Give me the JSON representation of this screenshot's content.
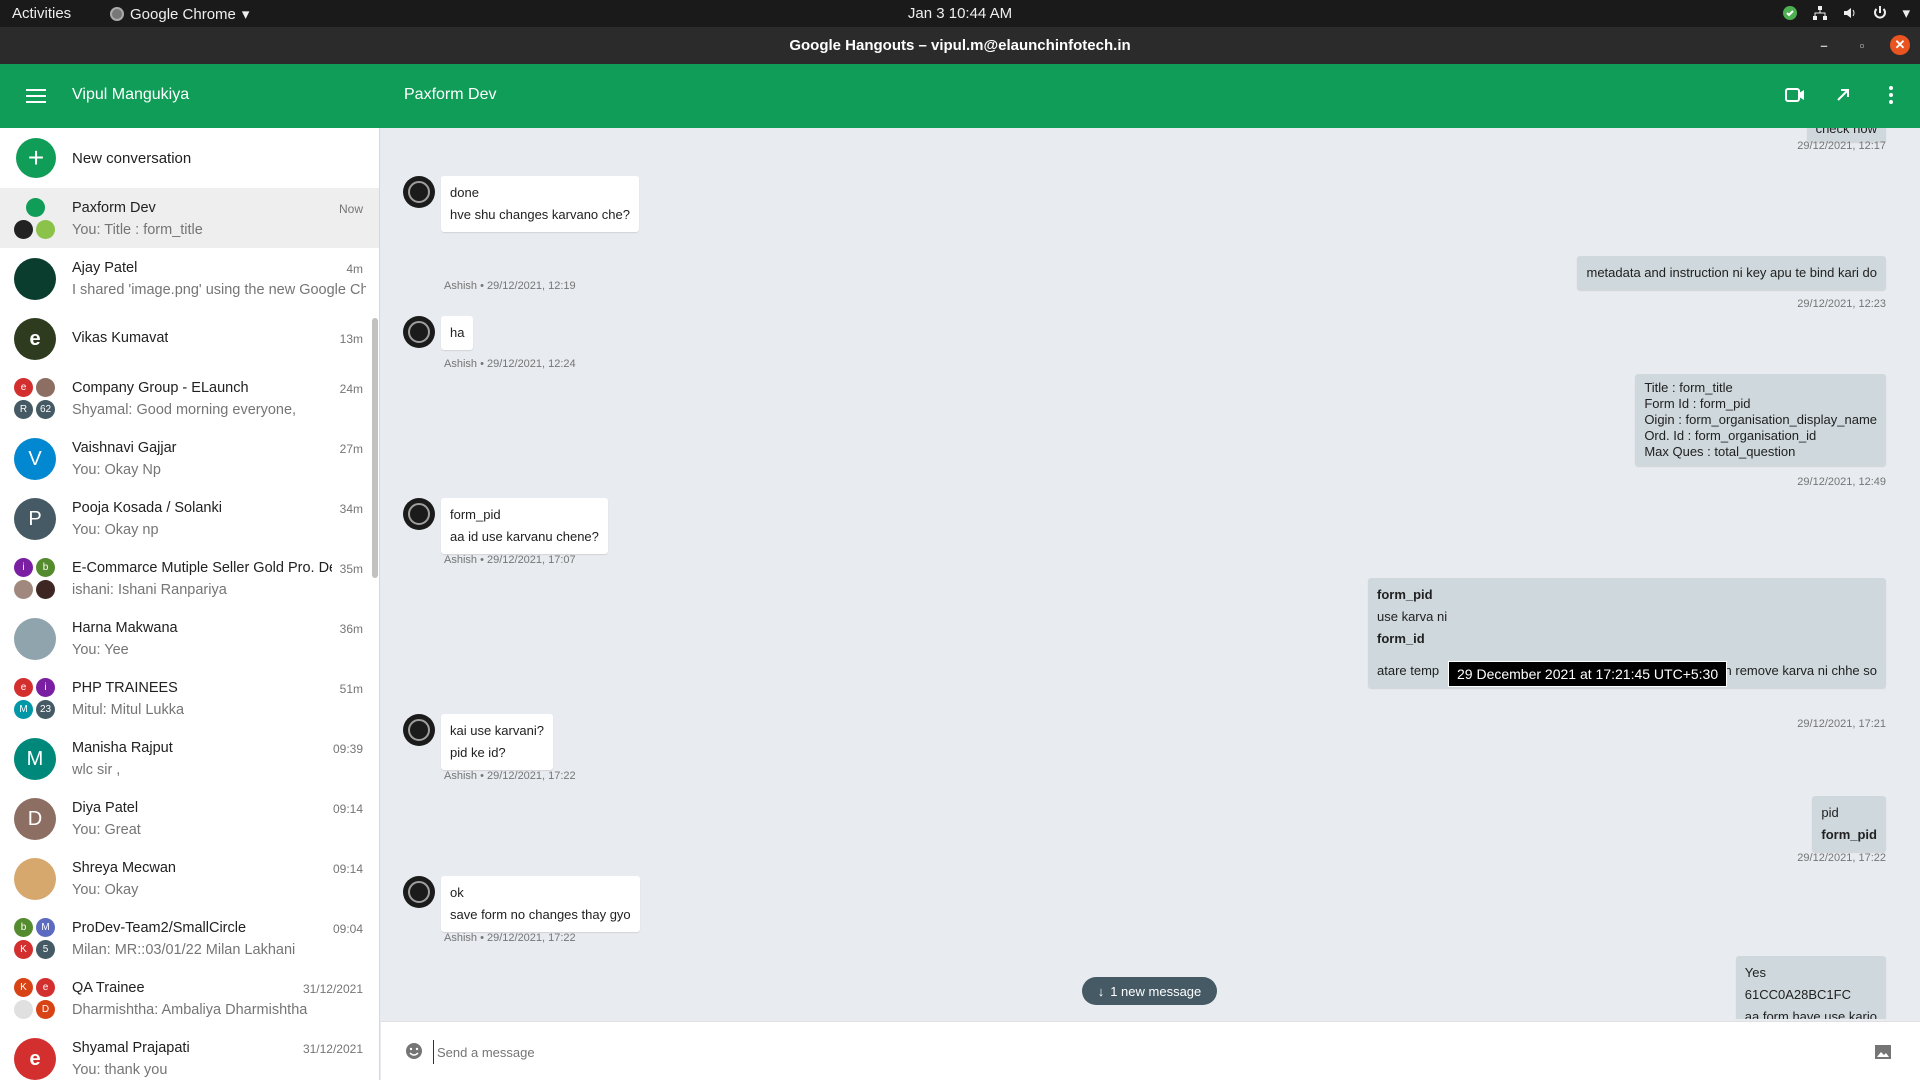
{
  "topbar": {
    "activities": "Activities",
    "app_name": "Google Chrome",
    "datetime": "Jan 3  10:44 AM"
  },
  "window": {
    "title": "Google Hangouts – vipul.m@elaunchinfotech.in"
  },
  "header": {
    "user_name": "Vipul Mangukiya",
    "conversation_title": "Paxform Dev"
  },
  "sidebar": {
    "new_conversation": "New conversation",
    "conversations": [
      {
        "name": "Paxform Dev",
        "snippet": "You: Title :  form_title",
        "time": "Now"
      },
      {
        "name": "Ajay Patel",
        "snippet": "I shared 'image.png' using the new Google Chat",
        "time": "4m"
      },
      {
        "name": "Vikas Kumavat",
        "snippet": "",
        "time": "13m",
        "initial": "e"
      },
      {
        "name": "Company Group - ELaunch",
        "snippet": "Shyamal: Good morning everyone,",
        "time": "24m",
        "a1": "e",
        "a3": "R",
        "a4": "62"
      },
      {
        "name": "Vaishnavi Gajjar",
        "snippet": "You: Okay  Np",
        "time": "27m",
        "initial": "V"
      },
      {
        "name": "Pooja Kosada / Solanki",
        "snippet": "You: Okay np",
        "time": "34m",
        "initial": "P"
      },
      {
        "name": "E-Commarce Mutiple Seller Gold Pro. Dev",
        "snippet": "ishani: Ishani Ranpariya",
        "time": "35m",
        "a1": "i",
        "a2": "b"
      },
      {
        "name": "Harna Makwana",
        "snippet": "You: Yee",
        "time": "36m"
      },
      {
        "name": "PHP TRAINEES",
        "snippet": "Mitul: Mitul Lukka",
        "time": "51m",
        "a1": "e",
        "a2": "i",
        "a3": "M",
        "a4": "23"
      },
      {
        "name": "Manisha Rajput",
        "snippet": "wlc sir ,",
        "time": "09:39",
        "initial": "M"
      },
      {
        "name": "Diya Patel",
        "snippet": "You: Great",
        "time": "09:14",
        "initial": "D"
      },
      {
        "name": "Shreya Mecwan",
        "snippet": "You: Okay",
        "time": "09:14"
      },
      {
        "name": "ProDev-Team2/SmallCircle",
        "snippet": "Milan: MR::03/01/22 Milan Lakhani",
        "time": "09:04",
        "a1": "b",
        "a2": "M",
        "a3": "K",
        "a4": "5"
      },
      {
        "name": "QA Trainee",
        "snippet": "Dharmishtha: Ambaliya Dharmishtha",
        "time": "31/12/2021",
        "a1": "K",
        "a2": "e",
        "a4": "D"
      },
      {
        "name": "Shyamal Prajapati",
        "snippet": "You: thank you",
        "time": "31/12/2021",
        "initial": "e"
      }
    ]
  },
  "messages": [
    {
      "lines": [
        "check now"
      ],
      "meta": "29/12/2021, 12:17"
    },
    {
      "lines": [
        "done",
        "hve shu changes karvano che?"
      ],
      "meta": "Ashish • 29/12/2021, 12:19"
    },
    {
      "lines": [
        "metadata and instruction ni  key apu te bind  kari do"
      ],
      "meta": "29/12/2021, 12:23"
    },
    {
      "lines": [
        "ha"
      ],
      "meta": "Ashish • 29/12/2021, 12:24"
    },
    {
      "lines": [
        "Title :  form_title",
        "Form Id : form_pid",
        "Oigin :  form_organisation_display_name",
        "Ord. Id : form_organisation_id",
        "Max Ques : total_question"
      ],
      "meta": "29/12/2021, 12:49"
    },
    {
      "lines": [
        "form_pid",
        "aa id use karvanu chene?"
      ],
      "meta": "Ashish • 29/12/2021, 17:07"
    },
    {
      "lines": [
        "form_pid",
        "use  karva ni",
        "form_id",
        "",
        "atare  temp",
        "n remove karva ni chhe so"
      ],
      "meta": "29/12/2021, 17:21"
    },
    {
      "lines": [
        "kai use karvani?",
        "pid ke id?"
      ],
      "meta": "Ashish • 29/12/2021, 17:22"
    },
    {
      "lines": [
        "pid",
        "form_pid"
      ],
      "meta": "29/12/2021, 17:22"
    },
    {
      "lines": [
        "ok",
        "save form no changes thay gyo"
      ],
      "meta": "Ashish • 29/12/2021, 17:22"
    },
    {
      "lines": [
        "Yes",
        "61CC0A28BC1FC",
        "aa  form have use kario"
      ]
    }
  ],
  "tooltip": "29 December 2021 at 17:21:45 UTC+5:30",
  "new_message_pill": "1 new message",
  "composer": {
    "placeholder": "Send a message"
  }
}
